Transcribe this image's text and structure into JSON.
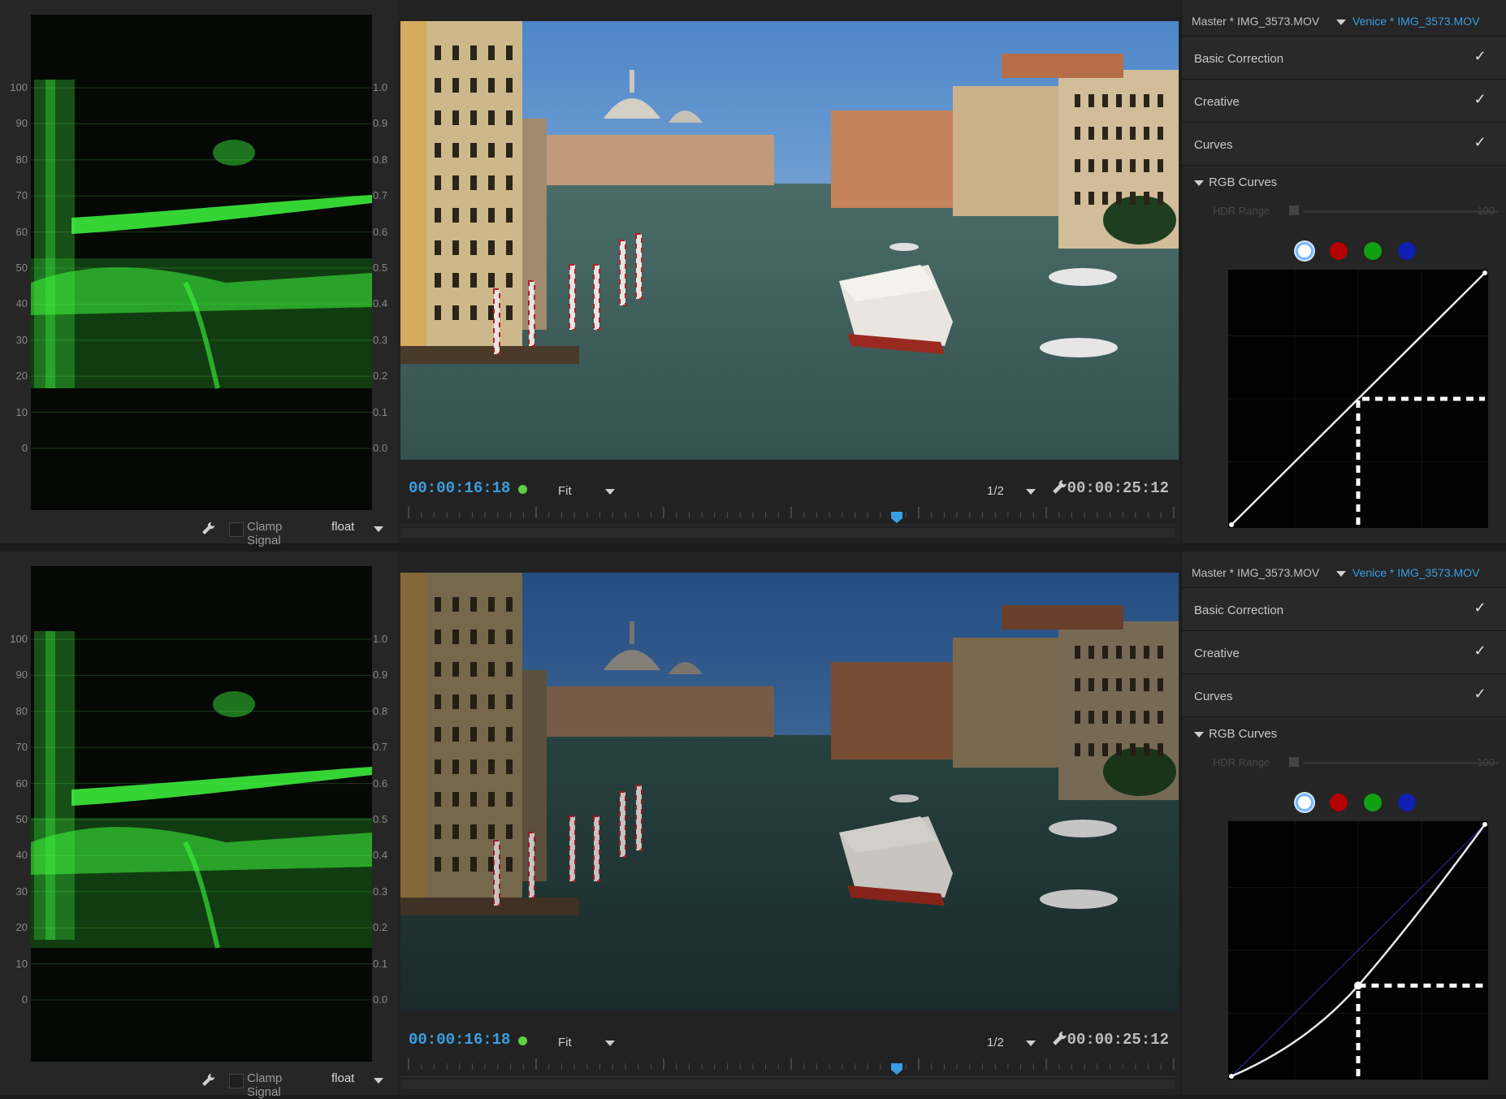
{
  "colors": {
    "accent_blue": "#3a9fe0",
    "scope_trace": "#3ef83e",
    "playback_dot": "#5bd245",
    "curve_white": "#e8e8f0",
    "curve_red": "#b40000",
    "curve_green": "#12a012",
    "curve_blue": "#1020b0"
  },
  "icons": [
    "wrench-icon",
    "dropdown-arrow-icon",
    "checkmark-icon",
    "disclosure-triangle-icon",
    "playhead-icon"
  ],
  "panels": [
    {
      "scope": {
        "left_scale": [
          "100",
          "90",
          "80",
          "70",
          "60",
          "50",
          "40",
          "30",
          "20",
          "10",
          "0"
        ],
        "right_scale": [
          "1.0",
          "0.9",
          "0.8",
          "0.7",
          "0.6",
          "0.5",
          "0.4",
          "0.3",
          "0.2",
          "0.1",
          "0.0"
        ],
        "clamp_label": "Clamp Signal",
        "clamp_checked": false,
        "mode": "float"
      },
      "monitor": {
        "current_timecode": "00:00:16:18",
        "zoom": "Fit",
        "resolution": "1/2",
        "duration_timecode": "00:00:25:12",
        "playhead_fraction": 0.64
      },
      "lumetri": {
        "master": "Master * IMG_3573.MOV",
        "clip": "Venice * IMG_3573.MOV",
        "sections": [
          {
            "label": "Basic Correction",
            "checked": true
          },
          {
            "label": "Creative",
            "checked": true
          },
          {
            "label": "Curves",
            "checked": true
          }
        ],
        "rgb_curves_label": "RGB Curves",
        "hdr_label": "HDR Range",
        "hdr_value": "100",
        "selected_channel": "white",
        "curve": "linear",
        "guide_point": {
          "input": 0.5,
          "output": 0.5
        }
      }
    },
    {
      "scope": {
        "left_scale": [
          "100",
          "90",
          "80",
          "70",
          "60",
          "50",
          "40",
          "30",
          "20",
          "10",
          "0"
        ],
        "right_scale": [
          "1.0",
          "0.9",
          "0.8",
          "0.7",
          "0.6",
          "0.5",
          "0.4",
          "0.3",
          "0.2",
          "0.1",
          "0.0"
        ],
        "clamp_label": "Clamp Signal",
        "clamp_checked": false,
        "mode": "float"
      },
      "monitor": {
        "current_timecode": "00:00:16:18",
        "zoom": "Fit",
        "resolution": "1/2",
        "duration_timecode": "00:00:25:12",
        "playhead_fraction": 0.64
      },
      "lumetri": {
        "master": "Master * IMG_3573.MOV",
        "clip": "Venice * IMG_3573.MOV",
        "sections": [
          {
            "label": "Basic Correction",
            "checked": true
          },
          {
            "label": "Creative",
            "checked": true
          },
          {
            "label": "Curves",
            "checked": true
          }
        ],
        "rgb_curves_label": "RGB Curves",
        "hdr_label": "HDR Range",
        "hdr_value": "100",
        "selected_channel": "white",
        "curve": "darkened",
        "control_point": {
          "input": 0.5,
          "output": 0.36
        }
      }
    }
  ]
}
